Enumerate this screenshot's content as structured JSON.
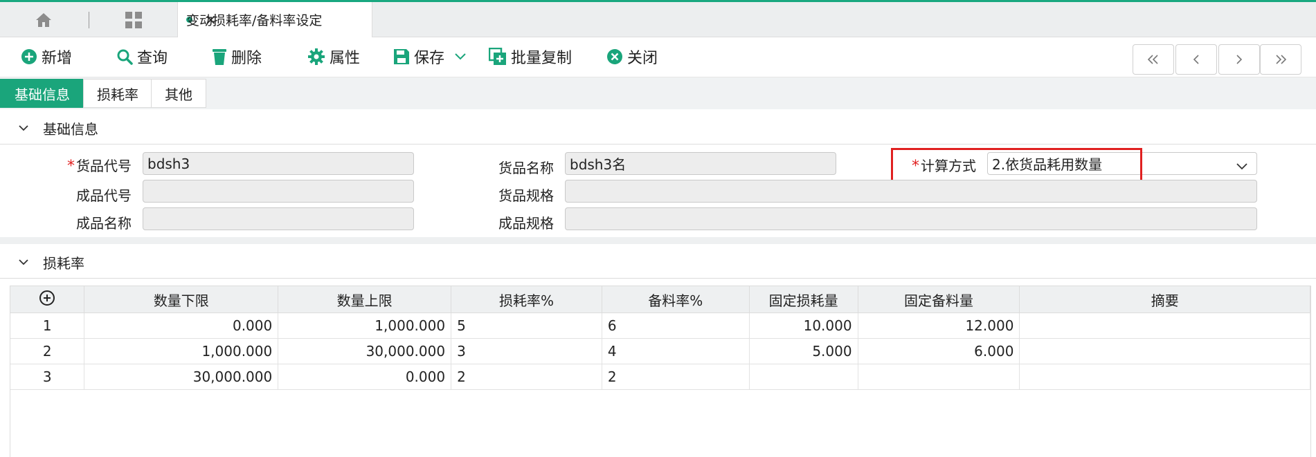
{
  "tab": {
    "title": "变动损耗率/备料率设定"
  },
  "toolbar": {
    "add": "新增",
    "query": "查询",
    "delete": "删除",
    "properties": "属性",
    "save": "保存",
    "batch_copy": "批量复制",
    "close": "关闭"
  },
  "subtabs": [
    "基础信息",
    "损耗率",
    "其他"
  ],
  "basic": {
    "section_title": "基础信息",
    "goods_code_label": "货品代号",
    "goods_code": "bdsh3",
    "goods_name_label": "货品名称",
    "goods_name": "bdsh3名",
    "calc_label": "计算方式",
    "calc_value": "2.依货品耗用数量",
    "product_code_label": "成品代号",
    "product_code": "",
    "goods_spec_label": "货品规格",
    "goods_spec": "",
    "product_name_label": "成品名称",
    "product_name": "",
    "product_spec_label": "成品规格",
    "product_spec": ""
  },
  "loss": {
    "section_title": "损耗率",
    "columns": [
      "数量下限",
      "数量上限",
      "损耗率%",
      "备料率%",
      "固定损耗量",
      "固定备料量",
      "摘要"
    ],
    "rows": [
      {
        "idx": "1",
        "min": "0.000",
        "max": "1,000.000",
        "loss": "5",
        "prep": "6",
        "fixed_loss": "10.000",
        "fixed_prep": "12.000",
        "note": ""
      },
      {
        "idx": "2",
        "min": "1,000.000",
        "max": "30,000.000",
        "loss": "3",
        "prep": "4",
        "fixed_loss": "5.000",
        "fixed_prep": "6.000",
        "note": ""
      },
      {
        "idx": "3",
        "min": "30,000.000",
        "max": "0.000",
        "loss": "2",
        "prep": "2",
        "fixed_loss": "",
        "fixed_prep": "",
        "note": ""
      }
    ]
  },
  "colors": {
    "accent": "#1aa57b",
    "highlight": "#e02020"
  }
}
